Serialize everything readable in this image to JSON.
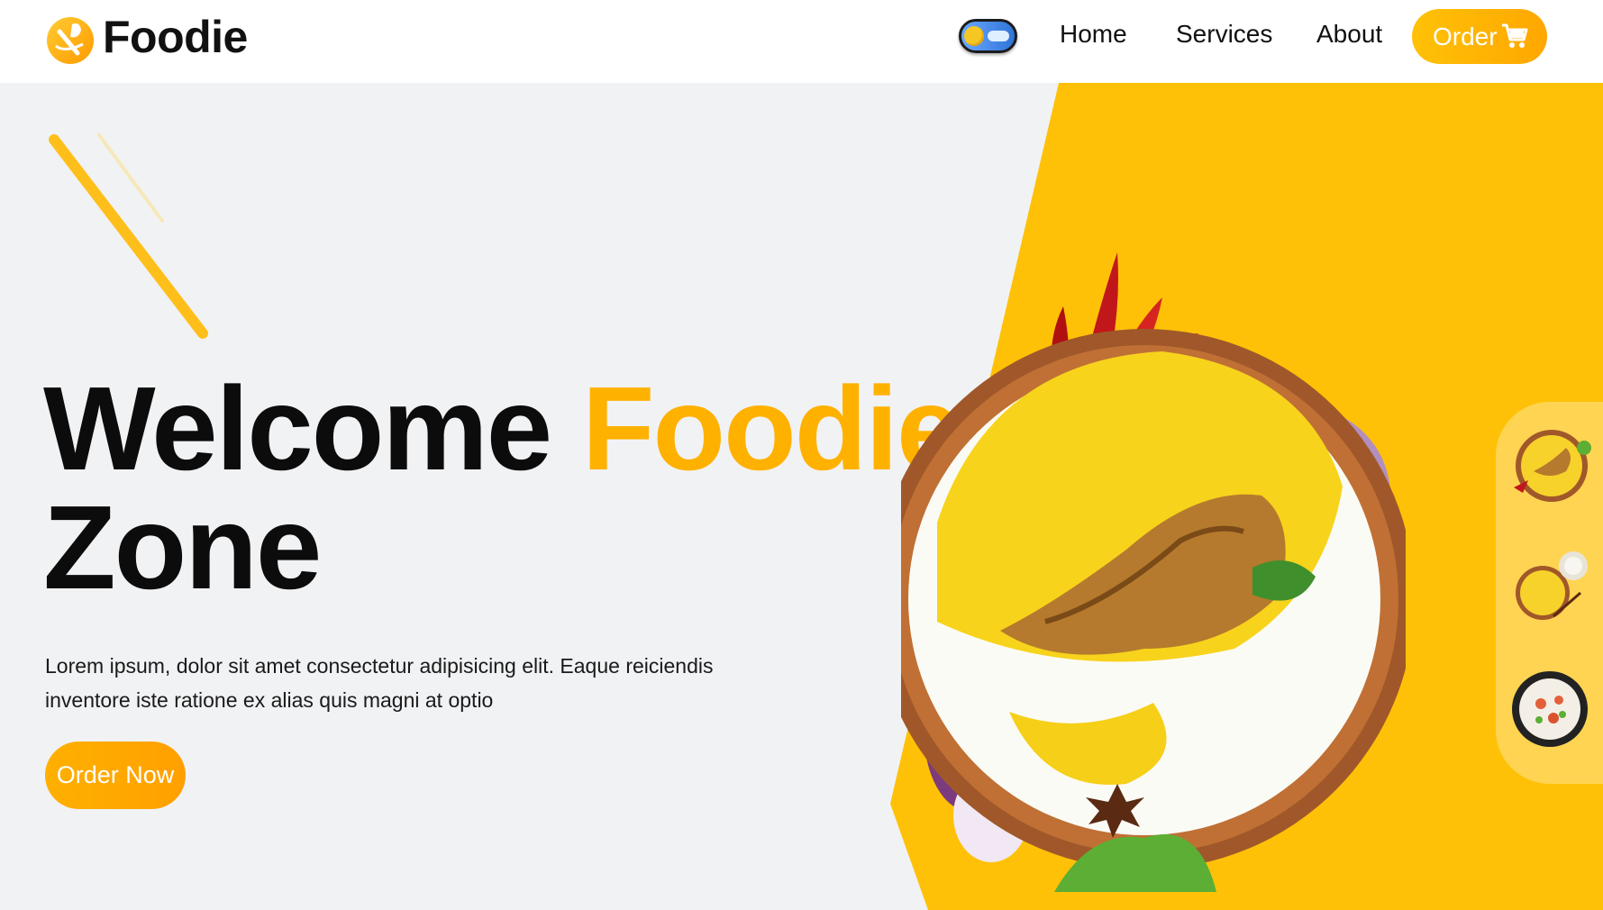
{
  "brand": {
    "name": "Foodie",
    "accent_color": "#ffb100",
    "logo_icon": "fork-spoon-plate-icon"
  },
  "nav": {
    "theme_toggle_icon": "sun-cloud-toggle-icon",
    "links": [
      "Home",
      "Services",
      "About"
    ],
    "order_label": "Order",
    "order_icon": "cart-icon"
  },
  "hero": {
    "title_part1": "Welcome",
    "title_accent": "Foodie",
    "title_part2": "Zone",
    "description": "Lorem ipsum, dolor sit amet consectetur adipisicing elit. Eaque reiciendis inventore iste ratione ex alias quis magni at optio",
    "cta_label": "Order Now",
    "main_image": "biryani-plate",
    "decor": "chopsticks"
  },
  "gallery": {
    "thumbnails": [
      "biryani-plate-thumb",
      "biryani-raita-thumb",
      "rice-bowl-thumb"
    ]
  },
  "colors": {
    "yellow": "#ffc107",
    "orange": "#ffa700",
    "background": "#f1f2f4",
    "rail": "#ffd452"
  }
}
